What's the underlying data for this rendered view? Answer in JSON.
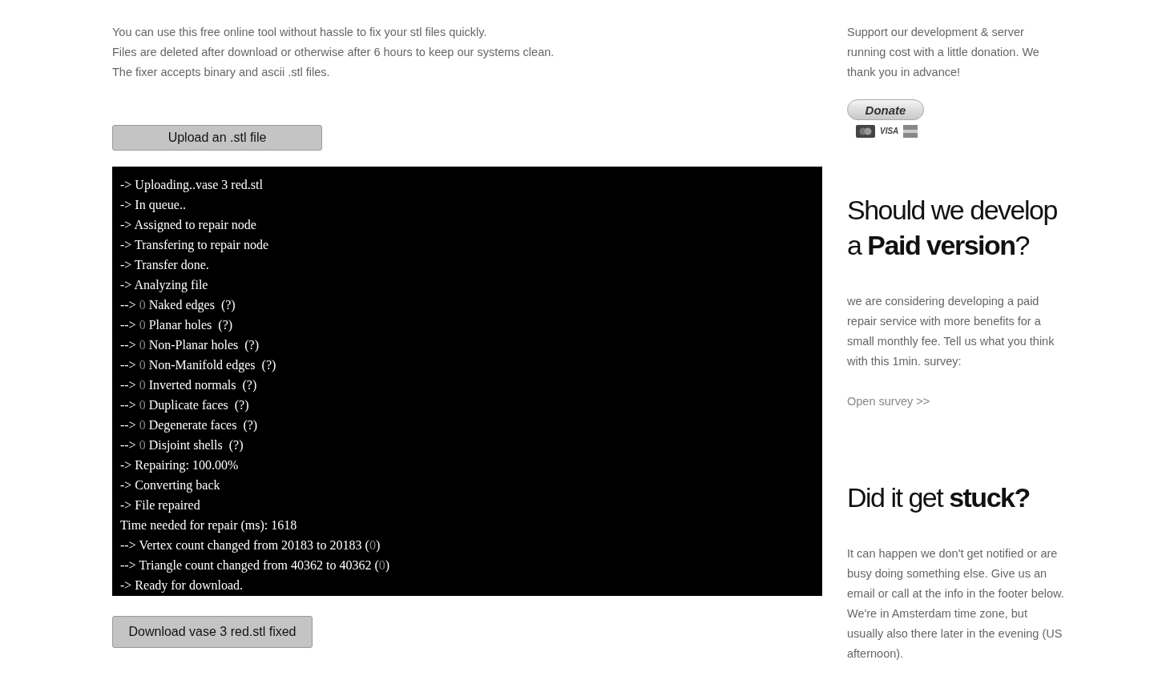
{
  "intro": [
    "You can use this free online tool without hassle to fix your stl files quickly.",
    "Files are deleted after download or otherwise after 6 hours to keep our systems clean.",
    "The fixer accepts binary and ascii .stl files."
  ],
  "upload_button": "Upload an .stl file",
  "log": [
    {
      "kind": "plain",
      "text": "-> Uploading..vase 3 red.stl"
    },
    {
      "kind": "plain",
      "text": "-> In queue.."
    },
    {
      "kind": "plain",
      "text": "-> Assigned to repair node"
    },
    {
      "kind": "plain",
      "text": "-> Transfering to repair node"
    },
    {
      "kind": "plain",
      "text": "-> Transfer done."
    },
    {
      "kind": "plain",
      "text": "-> Analyzing file"
    },
    {
      "kind": "count",
      "before": "-->",
      "count": "0",
      "after": "Naked edges  (?)"
    },
    {
      "kind": "count",
      "before": "-->",
      "count": "0",
      "after": "Planar holes  (?)"
    },
    {
      "kind": "count",
      "before": "-->",
      "count": "0",
      "after": "Non-Planar holes  (?)"
    },
    {
      "kind": "count",
      "before": "-->",
      "count": "0",
      "after": "Non-Manifold edges  (?)"
    },
    {
      "kind": "count",
      "before": "-->",
      "count": "0",
      "after": "Inverted normals  (?)"
    },
    {
      "kind": "count",
      "before": "-->",
      "count": "0",
      "after": "Duplicate faces  (?)"
    },
    {
      "kind": "count",
      "before": "-->",
      "count": "0",
      "after": "Degenerate faces  (?)"
    },
    {
      "kind": "count",
      "before": "-->",
      "count": "0",
      "after": "Disjoint shells  (?)"
    },
    {
      "kind": "plain",
      "text": "-> Repairing: 100.00%"
    },
    {
      "kind": "plain",
      "text": "-> Converting back"
    },
    {
      "kind": "plain",
      "text": "-> File repaired"
    },
    {
      "kind": "plain",
      "text": "Time needed for repair (ms): 1618"
    },
    {
      "kind": "delta",
      "before": "--> Vertex count changed from 20183 to 20183 (",
      "count": "0",
      "after": ")"
    },
    {
      "kind": "delta",
      "before": "--> Triangle count changed from 40362 to 40362 (",
      "count": "0",
      "after": ")"
    },
    {
      "kind": "plain",
      "text": "-> Ready for download."
    }
  ],
  "download_button": "Download vase 3 red.stl fixed",
  "sidebar": {
    "support_text": "Support our development & server running cost with a little donation. We thank you in advance!",
    "donate": {
      "label": "Donate",
      "cards": [
        {
          "kind": "mastercard"
        },
        {
          "kind": "visa",
          "label": "VISA"
        },
        {
          "kind": "amex"
        }
      ]
    },
    "sections": [
      {
        "heading": "Should we develop a **Paid version**?",
        "body": "we are considering developing a paid repair service with more benefits for a small monthly fee. Tell us what you think with this 1min. survey:",
        "link": "Open survey >>"
      },
      {
        "heading": "Did it get **stuck?**",
        "body": "It can happen we don't get notified or are busy doing something else. Give us an email or call at the info in the footer below. We're in Amsterdam time zone, but usually also there later in the evening (US afternoon)."
      }
    ]
  }
}
